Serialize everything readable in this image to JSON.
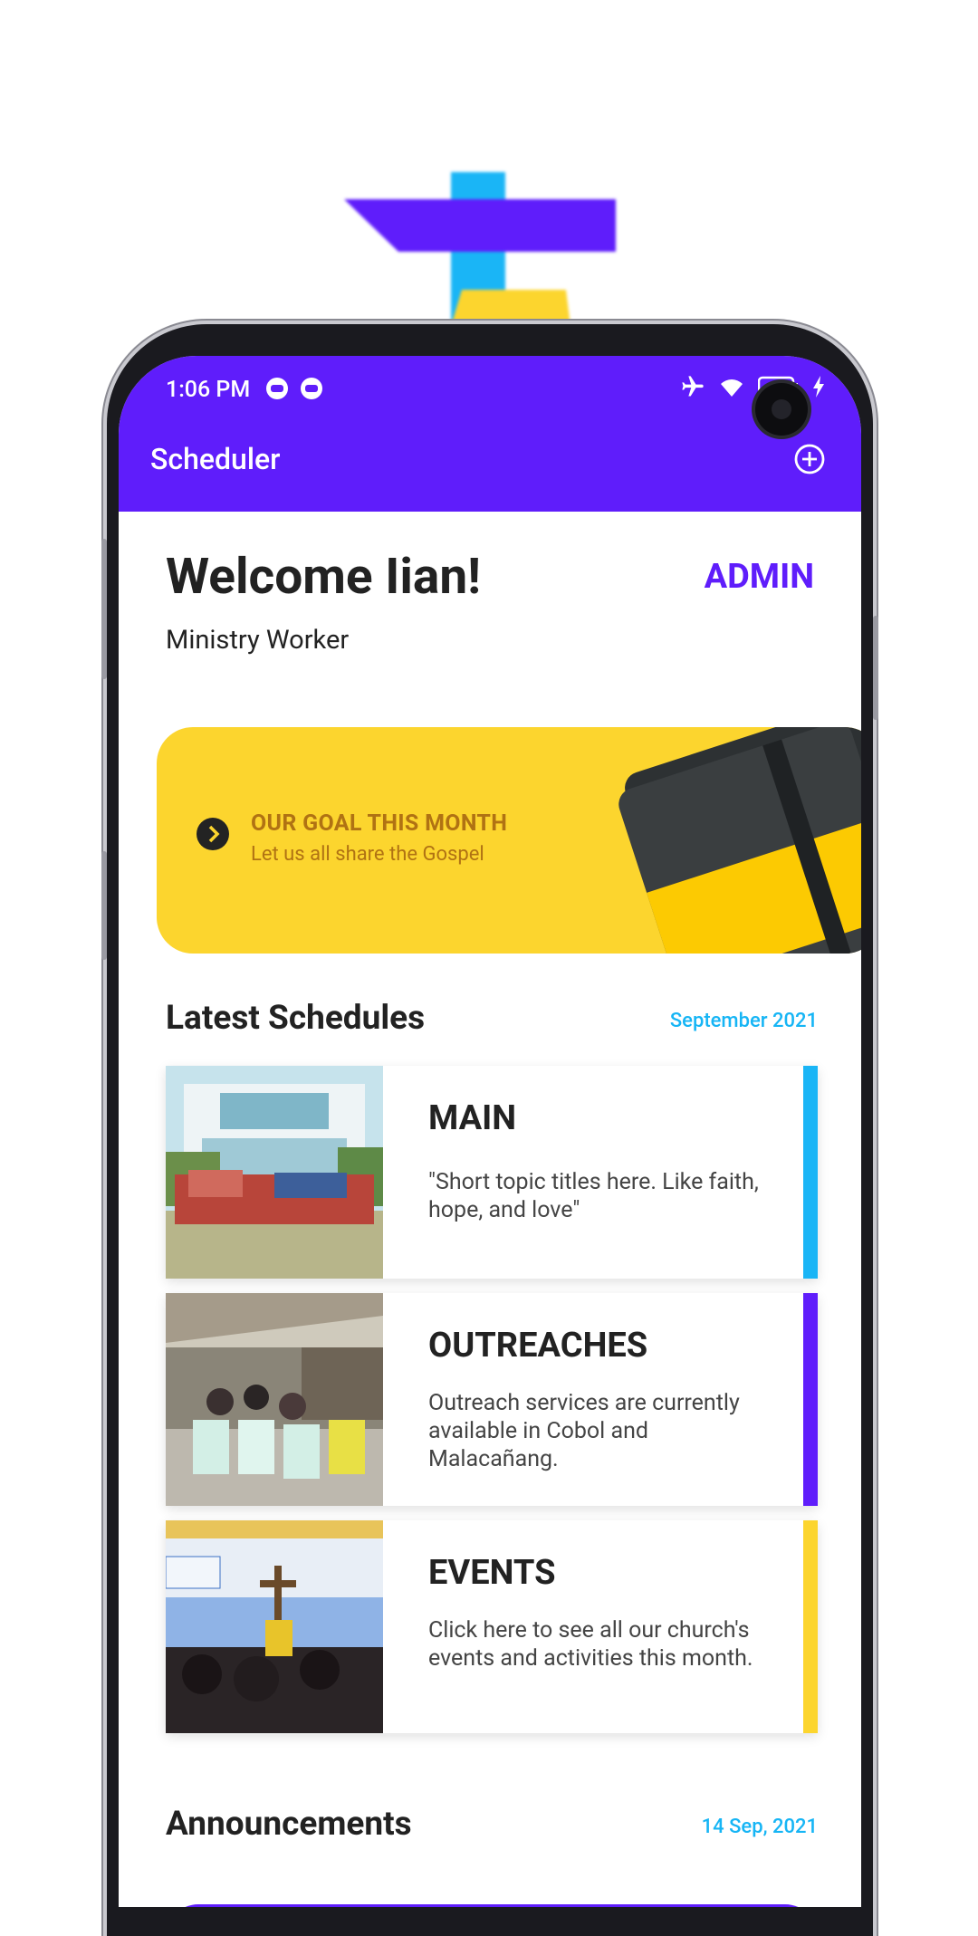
{
  "status_bar": {
    "time": "1:06 PM"
  },
  "app_bar": {
    "title": "Scheduler"
  },
  "header": {
    "welcome": "Welcome Iian!",
    "role_badge": "ADMIN",
    "subtitle": "Ministry Worker"
  },
  "goal_banner": {
    "title": "OUR GOAL THIS MONTH",
    "subtitle": "Let us all share the Gospel"
  },
  "latest_schedules": {
    "title": "Latest Schedules",
    "date": "September 2021",
    "cards": [
      {
        "title": "MAIN",
        "description": "\"Short topic titles here. Like faith, hope, and love\"",
        "accent": "#1ab5f6"
      },
      {
        "title": "OUTREACHES",
        "description": "Outreach services are currently available in Cobol and Malacañang.",
        "accent": "#5f1dfb"
      },
      {
        "title": "EVENTS",
        "description": "Click here to see all our church's events and activities this month.",
        "accent": "#fcd52e"
      }
    ]
  },
  "announcements": {
    "title": "Announcements",
    "date": "14 Sep, 2021"
  },
  "colors": {
    "primary": "#5f1dfb",
    "accent_blue": "#16b5f5",
    "goal_yellow": "#fcd52e"
  }
}
